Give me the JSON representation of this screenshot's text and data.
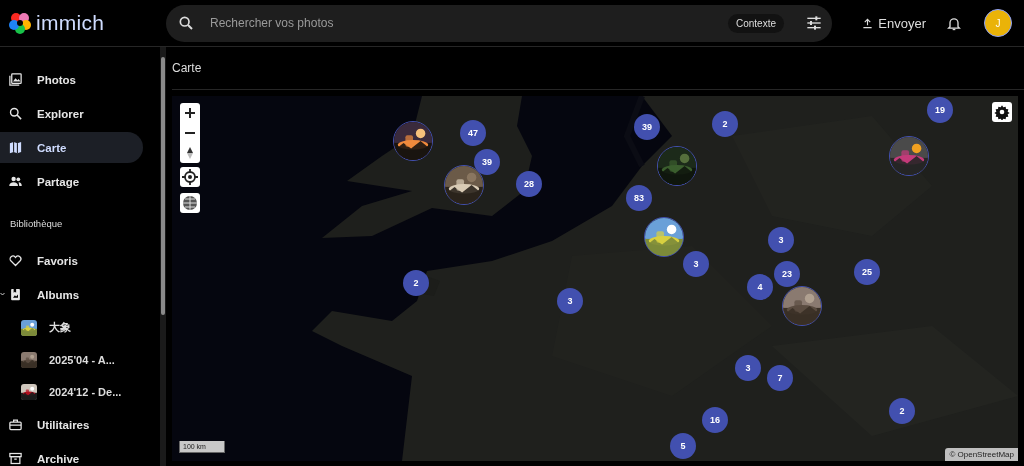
{
  "app": {
    "name": "immich"
  },
  "search": {
    "placeholder": "Rechercher vos photos",
    "context_button": "Contexte"
  },
  "header": {
    "upload_button": "Envoyer",
    "avatar": "J"
  },
  "sidebar": {
    "items": [
      {
        "kind": "photos",
        "label": "Photos",
        "selected": false
      },
      {
        "kind": "explore",
        "label": "Explorer",
        "selected": false
      },
      {
        "kind": "map",
        "label": "Carte",
        "selected": true
      },
      {
        "kind": "sharing",
        "label": "Partage",
        "selected": false
      },
      {
        "kind": "heading",
        "label": "Bibliothèque"
      },
      {
        "kind": "favorites",
        "label": "Favoris",
        "selected": false
      },
      {
        "kind": "albums",
        "label": "Albums",
        "selected": false,
        "expanded": true,
        "children": [
          {
            "label": "大象",
            "selected": false
          },
          {
            "label": "2025'04 - A...",
            "selected": false
          },
          {
            "label": "2024'12 - De...",
            "selected": false
          }
        ]
      },
      {
        "kind": "utilities",
        "label": "Utilitaires",
        "selected": false
      },
      {
        "kind": "archive",
        "label": "Archive",
        "selected": false
      }
    ]
  },
  "page_title": "Carte",
  "map": {
    "clusters": [
      {
        "count": "47"
      },
      {
        "count": "39"
      },
      {
        "count": "28"
      },
      {
        "count": "39"
      },
      {
        "count": "2"
      },
      {
        "count": "19"
      },
      {
        "count": "83"
      },
      {
        "count": "3"
      },
      {
        "count": "3"
      },
      {
        "count": "23"
      },
      {
        "count": "25"
      },
      {
        "count": "4"
      },
      {
        "count": "2"
      },
      {
        "count": "3"
      },
      {
        "count": "3"
      },
      {
        "count": "7"
      },
      {
        "count": "2"
      },
      {
        "count": "16"
      },
      {
        "count": "5"
      }
    ],
    "scale": "100 km",
    "attribution": "© OpenStreetMap"
  }
}
